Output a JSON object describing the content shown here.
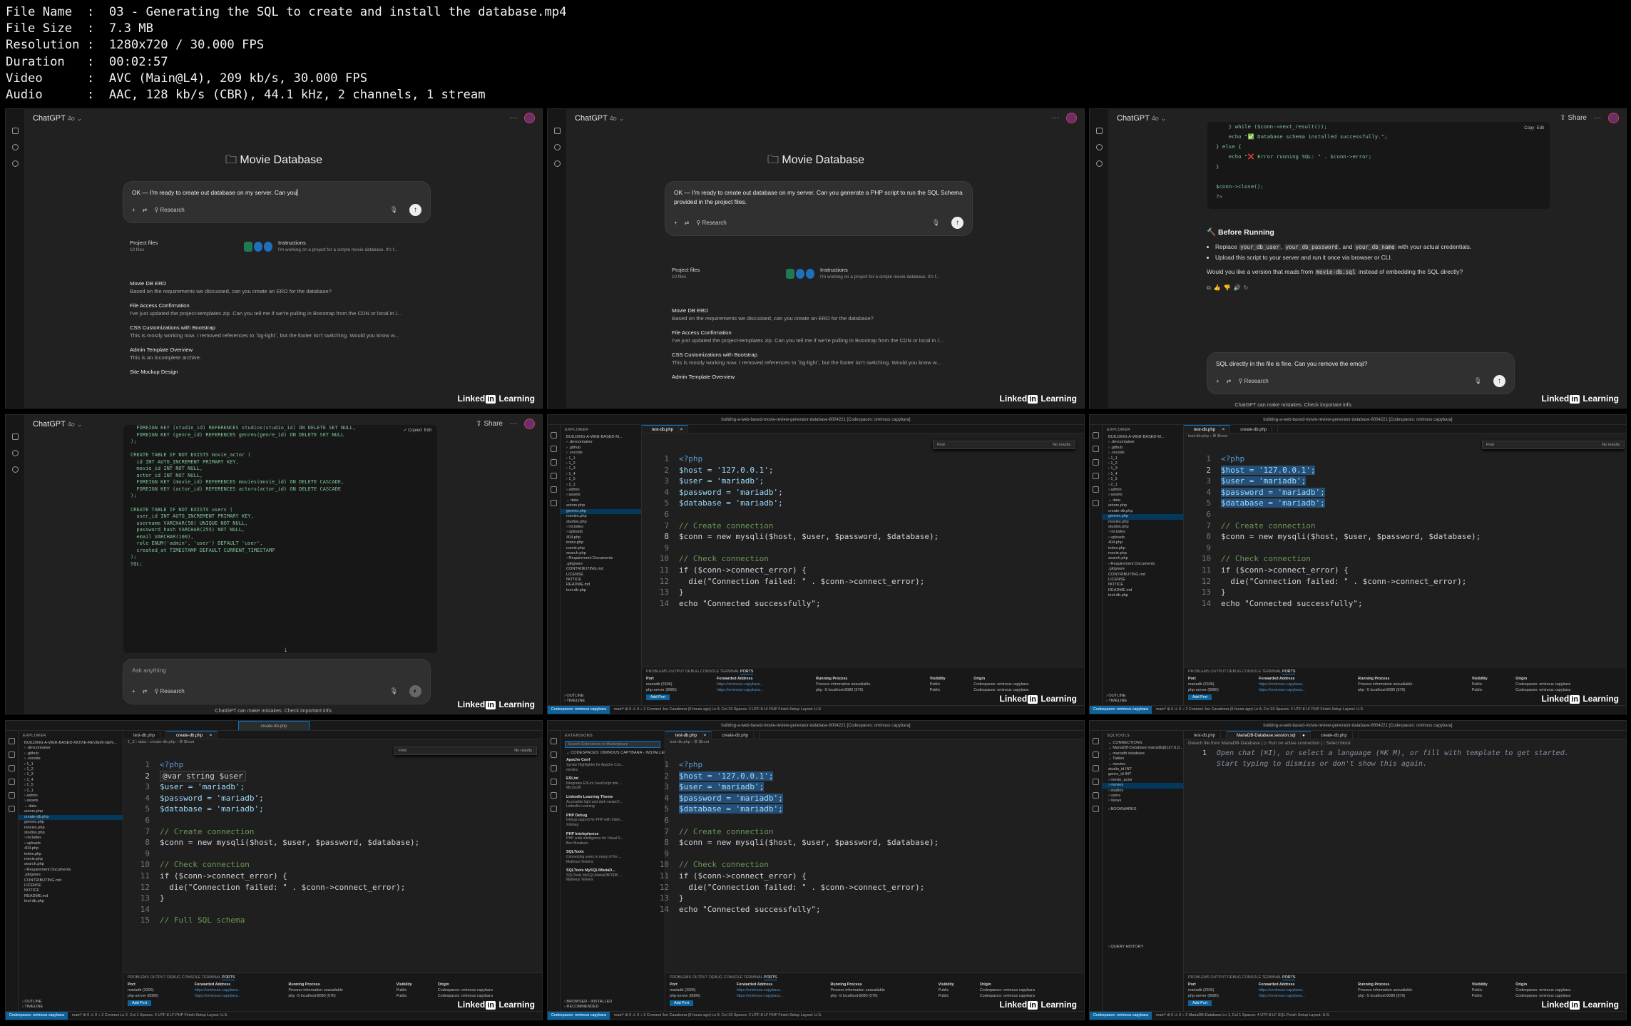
{
  "meta": [
    "File Name  :  03 - Generating the SQL to create and install the database.mp4",
    "File Size  :  7.3 MB",
    "Resolution :  1280x720 / 30.000 FPS",
    "Duration   :  00:02:57",
    "Video      :  AVC (Main@L4), 209 kb/s, 30.000 FPS",
    "Audio      :  AAC, 128 kb/s (CBR), 44.1 kHz, 2 channels, 1 stream"
  ],
  "chat": {
    "app": "ChatGPT",
    "model": "4o",
    "project": "Movie Database",
    "research": "Research",
    "share": "Share",
    "files_label": "Project files",
    "files_count": "10 files",
    "instr_label": "Instructions",
    "instr_text": "I'm working on a project for a simple movie database. It's f...",
    "disclaimer": "ChatGPT can make mistakes. Check important info.",
    "items": [
      {
        "title": "Movie DB ERD",
        "text": "Based on the requirements we discussed, can you create an ERD for the database?"
      },
      {
        "title": "File Access Confirmation",
        "text": "I've just updated the project-templates zip. Can you tell me if we're pulling in Boostrap from the CDN or local in /..."
      },
      {
        "title": "CSS Customizations with Bootstrap",
        "text": "This is mostly working now. I removed references to `bg-light`, but the footer isn't switching. Would you know w..."
      },
      {
        "title": "Admin Template Overview",
        "text": "This is an incomplete archive."
      },
      {
        "title": "Site Mockup Design",
        "text": ""
      }
    ]
  },
  "tile1": {
    "prompt": "OK — I'm ready to create out database on my server. Can you"
  },
  "tile2": {
    "prompt": "OK — I'm ready to create out database on my server. Can you generate a PHP script to run the SQL Schema provided in the project files."
  },
  "tile3": {
    "copy": "Copy",
    "edit": "Edit",
    "code": "    } while ($conn->next_result());\n    echo \"✅ Database schema installed successfully.\";\n} else {\n    echo \"❌ Error running SQL: \" . $conn->error;\n}\n\n$conn->close();\n?>",
    "heading": "Before Running",
    "b1a": "Replace",
    "c1": "your_db_user",
    "c2": "your_db_password",
    "b1b": "and",
    "c3": "your_db_name",
    "b1c": "with your actual credentials.",
    "b2": "Upload this script to your server and run it once via browser or CLI.",
    "q1": "Would you like a version that reads from",
    "c4": "movie-db.sql",
    "q2": "instead of embedding the SQL directly?",
    "prompt": "SQL directly in the file is fine. Can you remove the emoji?"
  },
  "tile4": {
    "copied": "✓ Copied",
    "placeholder": "Ask anything",
    "code": "  FOREIGN KEY (studio_id) REFERENCES studios(studio_id) ON DELETE SET NULL,\n  FOREIGN KEY (genre_id) REFERENCES genres(genre_id) ON DELETE SET NULL\n);\n\nCREATE TABLE IF NOT EXISTS movie_actor (\n  id INT AUTO_INCREMENT PRIMARY KEY,\n  movie_id INT NOT NULL,\n  actor_id INT NOT NULL,\n  FOREIGN KEY (movie_id) REFERENCES movies(movie_id) ON DELETE CASCADE,\n  FOREIGN KEY (actor_id) REFERENCES actors(actor_id) ON DELETE CASCADE\n);\n\nCREATE TABLE IF NOT EXISTS users (\n  user_id INT AUTO_INCREMENT PRIMARY KEY,\n  username VARCHAR(50) UNIQUE NOT NULL,\n  password_hash VARCHAR(255) NOT NULL,\n  email VARCHAR(100),\n  role ENUM('admin', 'user') DEFAULT 'user',\n  created_at TIMESTAMP DEFAULT CURRENT_TIMESTAMP\n);\nSQL;"
  },
  "tile7": {
    "hint": "@var string $user",
    "c3": "// Full SQL schema"
  },
  "php": {
    "open": "<?php",
    "host": "$host = '127.0.0.1';",
    "user": "$user = 'mariadb';",
    "pass": "$password = 'mariadb';",
    "db": "$database = 'mariadb';",
    "c1": "// Create connection",
    "conn": "$conn = new mysqli($host, $user, $password, $database);",
    "c2": "// Check connection",
    "if": "if ($conn->connect_error) {",
    "die": "  die(\"Connection failed: \" . $conn->connect_error);",
    "close": "}",
    "echo": "echo \"Connected successfully\";"
  },
  "vs": {
    "window_title": "building-a-web-based-movie-review-generator-database-8004221 [Codespaces: ominous capybara]",
    "explorer": "EXPLORER",
    "root": "BUILDING-A-WEB-BASED-M...",
    "root_long": "BUILDING-A-WEB-BASED-MOVIE-REVIEW-GEN...",
    "outline": "› OUTLINE",
    "timeline": "› TIMELINE",
    "tab_test": "test-db.php",
    "tab_create": "create-db.php",
    "crumb": "test-db.php › ⚙ $host",
    "crumb2": "1_3 › data › create-db.php › ⚙ $host",
    "find_placeholder": "Find",
    "no_results": "No results",
    "panel_tabs": "PROBLEMS   OUTPUT   DEBUG CONSOLE   TERMINAL",
    "ports_tab": "PORTS",
    "ports_cols": [
      "Port",
      "Forwarded Address",
      "Running Process",
      "Visibility",
      "Origin"
    ],
    "ports": [
      {
        "port": "mariadb (3306)",
        "addr": "https://ominous-capybara...",
        "proc": "Process information unavailable",
        "vis": "Public",
        "origin": "Codespaces: ominous capybara"
      },
      {
        "port": "php-server (8080)",
        "addr": "https://ominous-capybara...",
        "proc": "php -S localhost:8080 (576)",
        "vis": "Public",
        "origin": "Codespaces: ominous capybara"
      }
    ],
    "add_port": "Add Port",
    "remote": "Codespaces: ominous capybara",
    "status": "main*   ⊗ 0 ⚠ 0   ⑂ 2   Connect          Joe Casabona (6 hours ago)   Ln 8, Col 33   Spaces: 2   UTF-8   LF   PHP   Finish Setup   Layout: U.S.",
    "status2": "main*   ⊗ 0 ⚠ 0   ⑂ 2   Connect          Ln 2, Col 1   Spaces: 2   UTF-8   LF   PHP   Finish Setup   Layout: U.S.",
    "tree": [
      "› .devcontainer",
      "› .github",
      "› .vscode",
      "› 1_1",
      "› 1_2",
      "› 1_3",
      "› 1_4",
      "› 1_5",
      "› 2_1",
      "  › admin",
      "  › assets",
      "  ⌄ data",
      "    actors.php",
      "    genres.php",
      "    movies.php",
      "    studios.php",
      "  › includes",
      "  › uploads",
      "  404.php",
      "  index.php",
      "  movie.php",
      "  search.php",
      "› Requirement Documents",
      ".gitignore",
      "CONTRIBUTING.md",
      "LICENSE",
      "NOTICE",
      "README.md",
      "test-db.php"
    ],
    "tree6": [
      "› .devcontainer",
      "› .github",
      "› .vscode",
      "› 1_1",
      "› 1_2",
      "› 1_3",
      "› 1_4",
      "› 1_5",
      "› 2_1",
      "  › admin",
      "  › assets",
      "  ⌄ data",
      "    actors.php",
      "    create-db.php",
      "    genres.php",
      "    movies.php",
      "    studios.php",
      "  › includes",
      "  › uploads",
      "  404.php",
      "  index.php",
      "  movie.php",
      "  search.php",
      "› Requirement Documents",
      ".gitignore",
      "CONTRIBUTING.md",
      "LICENSE",
      "NOTICE",
      "README.md",
      "test-db.php"
    ]
  },
  "ext": {
    "header": "EXTENSIONS",
    "search": "Search Extensions in Marketplace",
    "section": "⌄ CODESPACES: OMINOUS CAPYBARA - INSTALLED",
    "browser": "› BROWSER - INSTALLED",
    "recommended": "› RECOMMENDED",
    "items": [
      {
        "name": "Apache Conf",
        "desc": "Syntax Highlighter for Apache Con...",
        "pub": "mrmlnc"
      },
      {
        "name": "ESLint",
        "desc": "Integrates ESLint JavaScript into ...",
        "pub": "Microsoft"
      },
      {
        "name": "LinkedIn Learning Theme",
        "desc": "Accessible light and dark variant f...",
        "pub": "LinkedIn Learning"
      },
      {
        "name": "PHP Debug",
        "desc": "Debug support for PHP with Xdeb...",
        "pub": "Xdebug"
      },
      {
        "name": "PHP Intelephense",
        "desc": "PHP code intelligence for Visual S...",
        "pub": "Ben Mewburn"
      },
      {
        "name": "SQLTools",
        "desc": "Connecting users to many of the ...",
        "pub": "Matheus Teixeira"
      },
      {
        "name": "SQLTools MySQL/MariaD...",
        "desc": "SQLTools MySQL/MariaDB/TiDB ...",
        "pub": "Matheus Teixeira"
      }
    ]
  },
  "sqlt": {
    "header": "SQLTOOLS",
    "connections": "⌄ CONNECTIONS",
    "tree": [
      "⌄ MariaDB-Database  mariadb@127.0.0...",
      "  ⌄ mariadb  database",
      "    ⌄ Tables",
      "      ⌄ movies",
      "          studio_id  INT",
      "          genre_id  INT",
      "      › movie_actor",
      "      › movies",
      "      › studios",
      "      › users",
      "    › Views"
    ],
    "bookmarks": "› BOOKMARKS",
    "history": "› QUERY HISTORY",
    "tab": "MariaDB-Database.session.sql",
    "codelens": "Detach file from MariaDB-Database | ▷ Run on active connection | ⁝ Select block",
    "hint1": "Open chat (⌘I), or select a language (⌘K M), or fill with template to get started.",
    "hint2": "Start typing to dismiss or don't show this again.",
    "status": "main*   ⊗ 0 ⚠ 0   ⑂ 2   MariaDB-Database          Ln 1, Col 1   Spaces: 4   UTF-8   LF   SQL   Finish Setup   Layout: U.S."
  }
}
